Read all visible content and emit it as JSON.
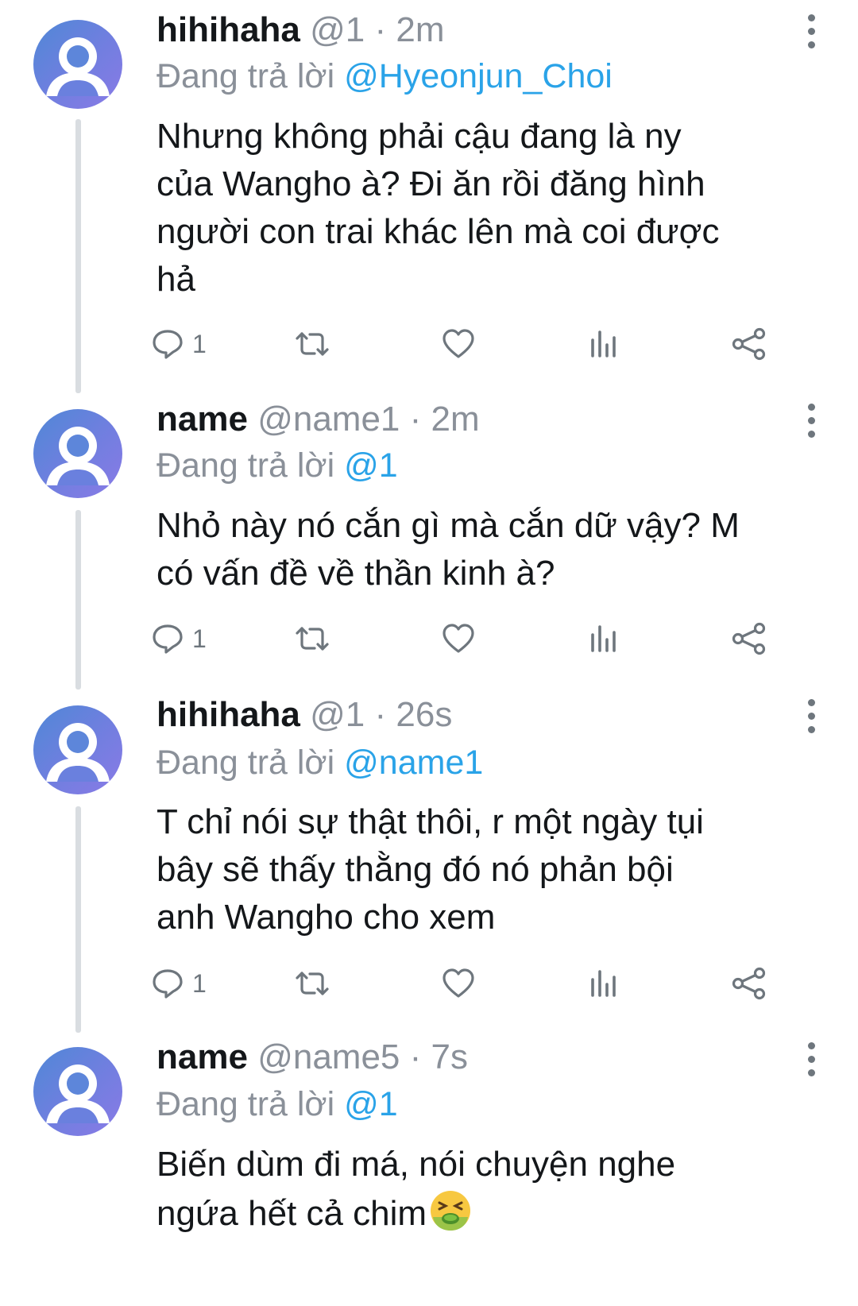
{
  "tweets": [
    {
      "display_name": "hihihaha",
      "handle": "@1",
      "time": "2m",
      "replying_prefix": "Đang trả lời",
      "replying_to": "@Hyeonjun_Choi",
      "body_lines": [
        "Nhưng không phải cậu đang là ny",
        "của Wangho à? Đi ăn rồi đăng hình",
        "người con trai khác lên mà coi được",
        "hả"
      ],
      "reply_count": "1"
    },
    {
      "display_name": "name",
      "handle": "@name1",
      "time": "2m",
      "replying_prefix": "Đang trả lời",
      "replying_to": "@1",
      "body_lines": [
        "Nhỏ này nó cắn gì mà cắn dữ vậy? M",
        "có vấn đề về thần kinh à?"
      ],
      "reply_count": "1"
    },
    {
      "display_name": "hihihaha",
      "handle": "@1",
      "time": "26s",
      "replying_prefix": "Đang trả lời",
      "replying_to": "@name1",
      "body_lines": [
        "T chỉ nói sự thật thôi, r một ngày tụi",
        "bây sẽ thấy thằng đó nó phản bội",
        "anh Wangho cho xem"
      ],
      "reply_count": "1"
    },
    {
      "display_name": "name",
      "handle": "@name5",
      "time": "7s",
      "replying_prefix": "Đang trả lời",
      "replying_to": "@1",
      "body_lines": [
        "Biến dùm đi má, nói chuyện nghe",
        "ngứa hết cả chim"
      ],
      "trailing_emoji": "nauseated-face-emoji"
    }
  ],
  "icons": {
    "reply": "reply-icon",
    "retweet": "retweet-icon",
    "like": "heart-icon",
    "analytics": "analytics-icon",
    "share": "share-icon",
    "more": "more-vertical-icon"
  },
  "colors": {
    "mention": "#2aa3e8",
    "secondary_text": "#8a9099",
    "thread_line": "#d9dde1"
  }
}
